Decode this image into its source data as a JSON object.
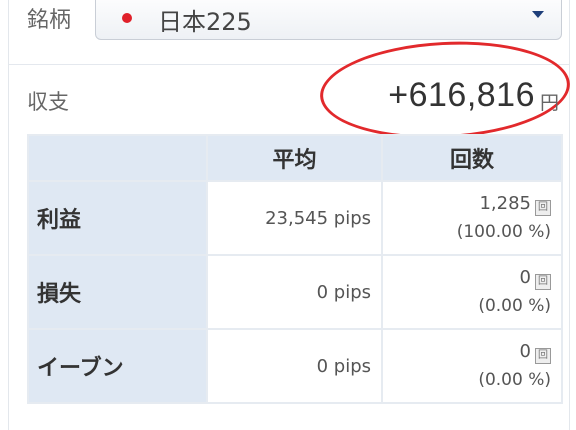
{
  "header": {
    "instrument_label": "銘柄",
    "selected_instrument": "日本225",
    "flag_icon": "japan-flag-icon",
    "caret_icon": "chevron-down-icon"
  },
  "pl": {
    "label": "収支",
    "amount": "+616,816",
    "unit": "円",
    "highlight_color": "#e2292c"
  },
  "table": {
    "columns": [
      "平均",
      "回数"
    ],
    "rows": [
      {
        "label": "利益",
        "avg": "23,545 pips",
        "count": "1,285",
        "count_unit": "回",
        "pct": "(100.00 %)"
      },
      {
        "label": "損失",
        "avg": "0 pips",
        "count": "0",
        "count_unit": "回",
        "pct": "(0.00 %)"
      },
      {
        "label": "イーブン",
        "avg": "0 pips",
        "count": "0",
        "count_unit": "回",
        "pct": "(0.00 %)"
      }
    ],
    "header_bg": "#dfe8f3"
  }
}
